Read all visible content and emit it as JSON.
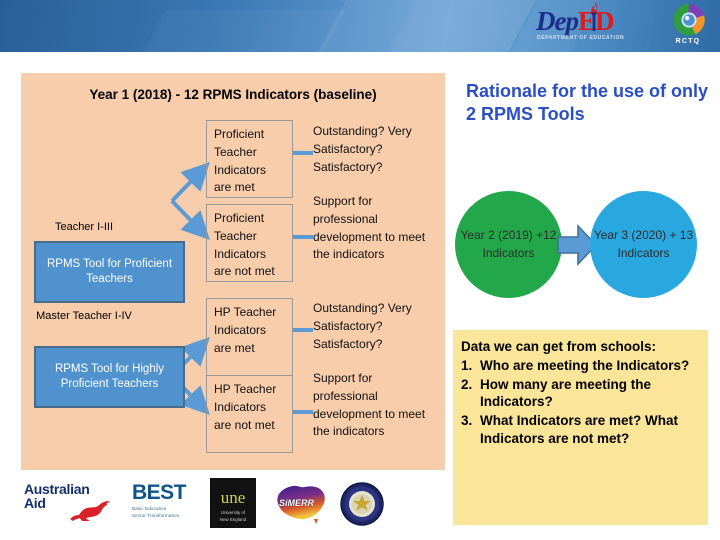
{
  "header": {
    "brand_primary": "Dep",
    "brand_secondary": "ED",
    "brand_subtitle": "DEPARTMENT OF EDUCATION",
    "rctq_label": "RCTQ",
    "logo_icons": [
      "deped-torch-icon",
      "rctq-circle-icon"
    ]
  },
  "colors": {
    "header_blue": "#3a77b4",
    "panel_peach": "#f8cdab",
    "tool_blue": "#4f92ce",
    "rationale_blue": "#2a4fc4",
    "oval_green": "#22a84a",
    "oval_cyan": "#29a8e0",
    "note_yellow": "#fbe599",
    "arrow_blue": "#5b9bd5"
  },
  "panel": {
    "title": "Year 1 (2018)  - 12 RPMS Indicators (baseline)",
    "rows": [
      {
        "group_label": "Teacher I-III",
        "tool_label": "RPMS Tool for Proficient Teachers",
        "branches": [
          {
            "indicator": "Proficient Teacher Indicators are met",
            "rating": "Outstanding? Very Satisfactory? Satisfactory?"
          },
          {
            "indicator": "Proficient Teacher Indicators are not met",
            "rating": "Support for professional development to meet the indicators"
          }
        ]
      },
      {
        "group_label": "Master Teacher I-IV",
        "tool_label": "RPMS Tool for Highly Proficient Teachers",
        "branches": [
          {
            "indicator": "HP Teacher Indicators are met",
            "rating": "Outstanding? Very Satisfactory? Satisfactory?"
          },
          {
            "indicator": "HP Teacher Indicators are not met",
            "rating": "Support for professional development to meet the indicators"
          }
        ]
      }
    ]
  },
  "rationale": {
    "heading": "Rationale for the use of only 2 RPMS Tools",
    "year2": "Year 2 (2019) +12 Indicators",
    "year3": "Year 3 (2020) + 13 Indicators"
  },
  "data_note": {
    "lead": "Data we can get from schools:",
    "items": [
      "Who are meeting the Indicators?",
      "How many are meeting the Indicators?",
      "What Indicators are met? What Indicators are not met?"
    ]
  },
  "partner_logos": {
    "aid_line1": "Australian",
    "aid_line2": "Aid",
    "best_word": "BEST",
    "best_sub_line1": "Basic Education",
    "best_sub_line2": "Sector Transformation",
    "une_word": "une",
    "une_sub_line1": "University of",
    "une_sub_line2": "New England",
    "simerr_word": "SiMERR"
  }
}
